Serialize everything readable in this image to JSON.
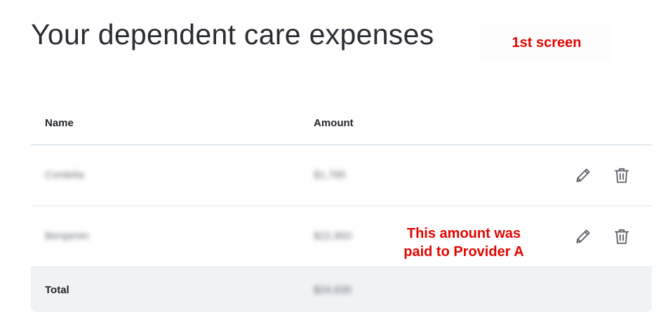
{
  "page": {
    "title": "Your dependent care expenses"
  },
  "annotations": {
    "screen_label": "1st screen",
    "amount_note_line1": "This amount was",
    "amount_note_line2": "paid to Provider A"
  },
  "table": {
    "headers": {
      "name": "Name",
      "amount": "Amount"
    },
    "rows": [
      {
        "name": "Cordelia",
        "amount": "$1,785"
      },
      {
        "name": "Benjamin",
        "amount": "$22,850"
      }
    ],
    "total": {
      "label": "Total",
      "amount": "$24,635"
    }
  },
  "icons": {
    "edit": "pencil-icon",
    "delete": "trash-icon"
  },
  "colors": {
    "annotation": "#e10600",
    "total_row_bg": "#f0f3f6",
    "header_divider": "#c9d6e3"
  }
}
